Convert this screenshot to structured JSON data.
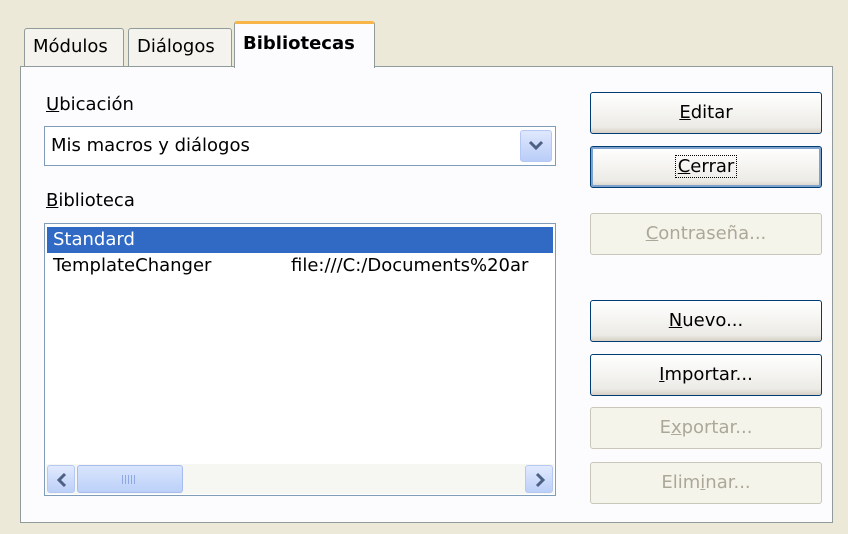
{
  "tabs": [
    {
      "label": "Módulos",
      "active": false
    },
    {
      "label": "Diálogos",
      "active": false
    },
    {
      "label": "Bibliotecas",
      "active": true
    }
  ],
  "location": {
    "label_first": "U",
    "label_rest": "bicación",
    "value": "Mis macros y diálogos"
  },
  "library": {
    "label_first": "B",
    "label_rest": "iblioteca",
    "rows": [
      {
        "name": "Standard",
        "path": "",
        "selected": true
      },
      {
        "name": "TemplateChanger",
        "path": "file:///C:/Documents%20ar",
        "selected": false
      }
    ]
  },
  "buttons": {
    "edit": {
      "pre": "",
      "u": "E",
      "post": "ditar",
      "enabled": true
    },
    "close": {
      "pre": "",
      "u": "C",
      "post": "errar",
      "enabled": true
    },
    "password": {
      "pre": "",
      "u": "C",
      "post": "ontraseña...",
      "enabled": false
    },
    "new": {
      "pre": "",
      "u": "N",
      "post": "uevo...",
      "enabled": true
    },
    "import": {
      "pre": "",
      "u": "I",
      "post": "mportar...",
      "enabled": true
    },
    "export": {
      "pre": "E",
      "u": "x",
      "post": "portar...",
      "enabled": false
    },
    "delete": {
      "pre": "Elim",
      "u": "i",
      "post": "nar...",
      "enabled": false
    }
  },
  "colors": {
    "selection": "#316ac5",
    "tab_accent": "#f7b54a",
    "button_border": "#003c74",
    "disabled_text": "#aca899"
  },
  "icons": {
    "combo_arrow": "chevron-down-icon",
    "scroll_left": "chevron-left-icon",
    "scroll_right": "chevron-right-icon"
  }
}
